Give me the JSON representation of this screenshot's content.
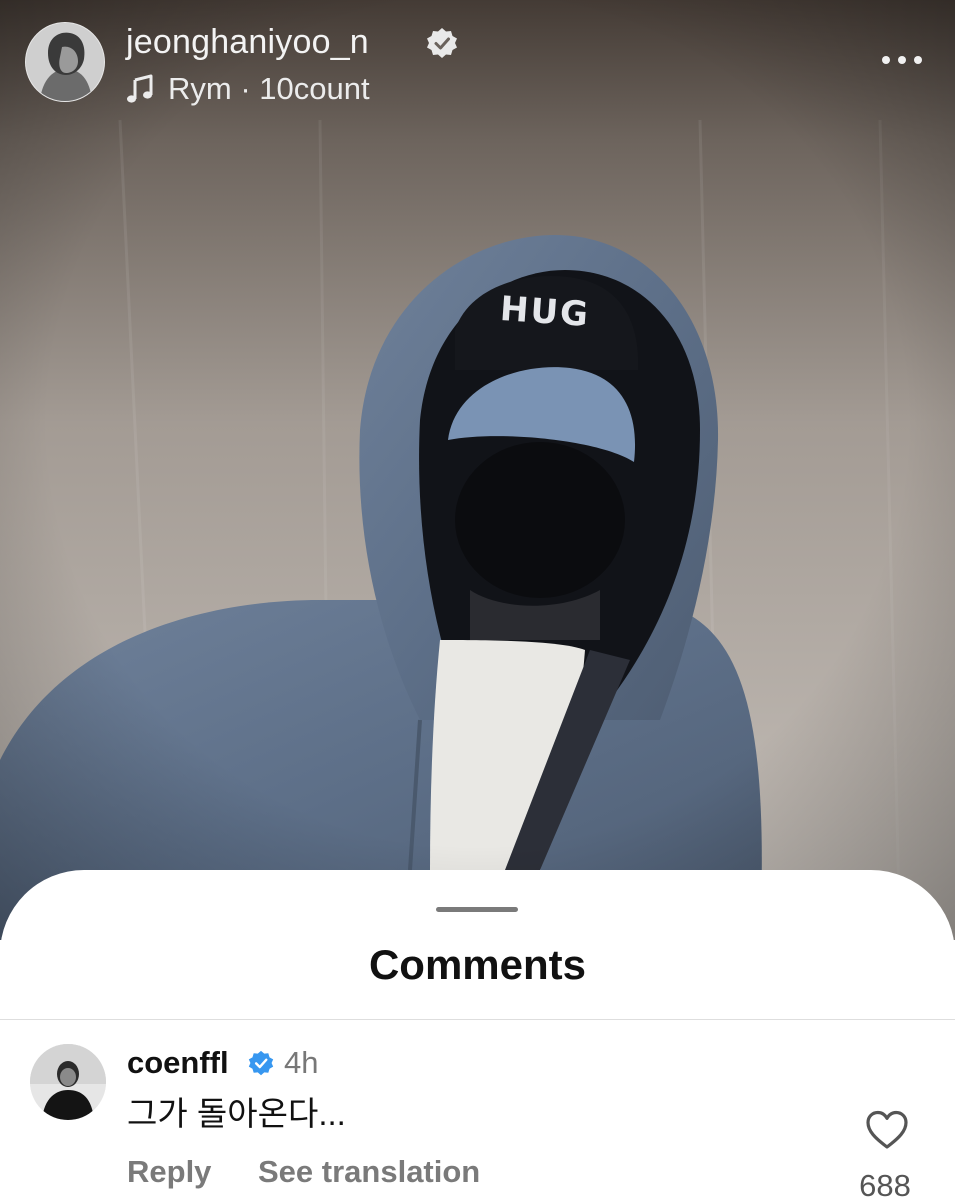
{
  "post": {
    "username": "jeonghaniyoo_n",
    "verified": true,
    "audio": "Rym · 10count",
    "more_icon": "more-horizontal-icon",
    "music_icon": "music-note-icon",
    "cap_text": "HUG"
  },
  "comments_sheet": {
    "title": "Comments",
    "comments": [
      {
        "username": "coenffl",
        "verified": true,
        "time": "4h",
        "text": "그가 돌아온다...",
        "reply_label": "Reply",
        "translation_label": "See translation",
        "like_count": "688"
      }
    ]
  },
  "colors": {
    "verified_badge": "#3797f0",
    "header_text": "#f3f3f3",
    "secondary_text": "#7a7a7a",
    "hoodie": "#6f84a0"
  }
}
